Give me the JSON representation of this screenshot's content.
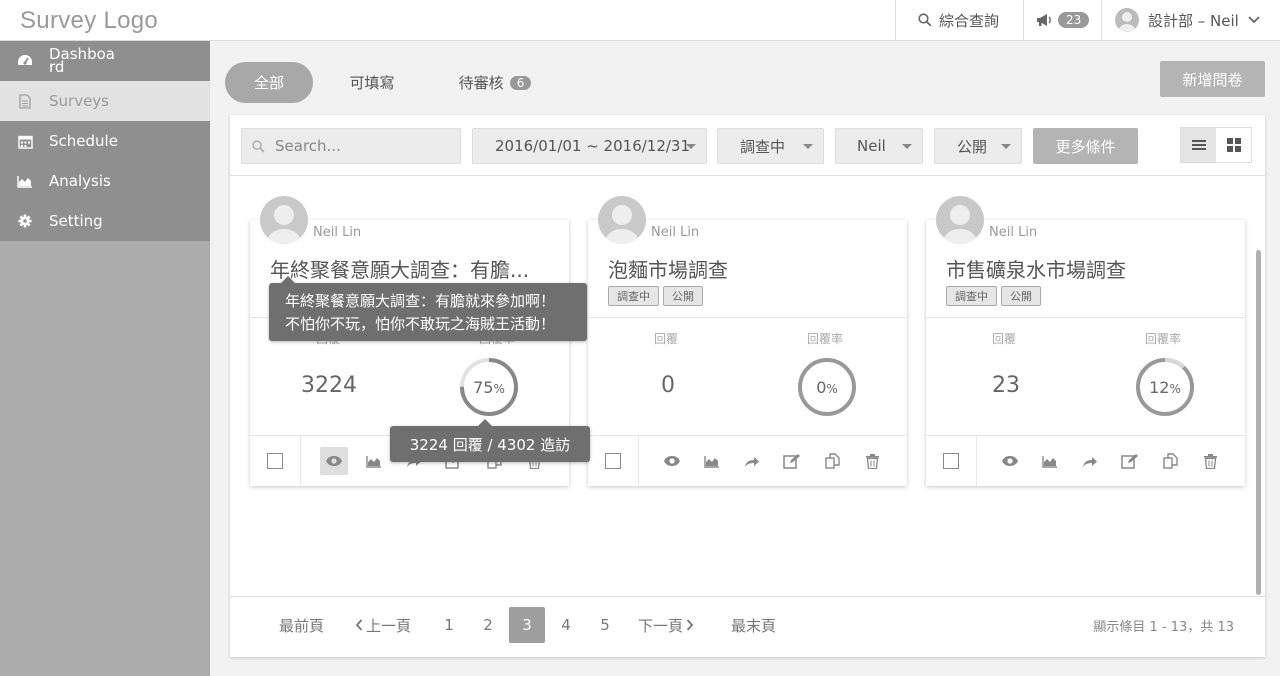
{
  "app": {
    "logo": "Survey Logo"
  },
  "topbar": {
    "search_label": "綜合查詢",
    "notifications_count": "23",
    "user_label": "設計部 – Neil"
  },
  "sidebar": {
    "items": [
      {
        "label": "Dashboard",
        "icon": "dashboard-icon"
      },
      {
        "label": "Surveys",
        "icon": "document-icon",
        "active": true
      },
      {
        "label": "Schedule",
        "icon": "calendar-icon"
      },
      {
        "label": "Analysis",
        "icon": "area-chart-icon"
      },
      {
        "label": "Setting",
        "icon": "gear-icon"
      }
    ]
  },
  "tabs": {
    "all": "全部",
    "fillable": "可填寫",
    "pending": "待審核",
    "pending_count": "6"
  },
  "add_button": "新增問卷",
  "filters": {
    "search_placeholder": "Search...",
    "date_range": "2016/01/01 ~ 2016/12/31",
    "status": "調查中",
    "user": "Neil",
    "visibility": "公開",
    "more": "更多條件"
  },
  "cards": [
    {
      "author": "Neil Lin",
      "title": "年終聚餐意願大調查：有膽...",
      "replies_label": "回覆",
      "rate_label": "回覆率",
      "replies": "3224",
      "rate": "75",
      "rate_unit": "%"
    },
    {
      "author": "Neil Lin",
      "title": "泡麵市場調查",
      "tag_status": "調查中",
      "tag_visibility": "公開",
      "replies_label": "回覆",
      "rate_label": "回覆率",
      "replies": "0",
      "rate": "0",
      "rate_unit": "%"
    },
    {
      "author": "Neil Lin",
      "title": "市售礦泉水市場調查",
      "tag_status": "調查中",
      "tag_visibility": "公開",
      "replies_label": "回覆",
      "rate_label": "回覆率",
      "replies": "23",
      "rate": "12",
      "rate_unit": "%"
    }
  ],
  "tooltips": {
    "title_line1": "年終聚餐意願大調查：有膽就來參加啊！",
    "title_line2": "不怕你不玩，怕你不敢玩之海賊王活動！",
    "stat": "3224 回覆 / 4302 造訪"
  },
  "pagination": {
    "first": "最前頁",
    "prev": "上一頁",
    "pages": [
      "1",
      "2",
      "3",
      "4",
      "5"
    ],
    "current": "3",
    "next": "下一頁",
    "last": "最末頁",
    "info": "顯示條目 1 - 13，共 13"
  },
  "colors": {
    "sidebar": "#ababab",
    "active_pill": "#a8a8a8",
    "tooltip": "#6f6f6f"
  }
}
